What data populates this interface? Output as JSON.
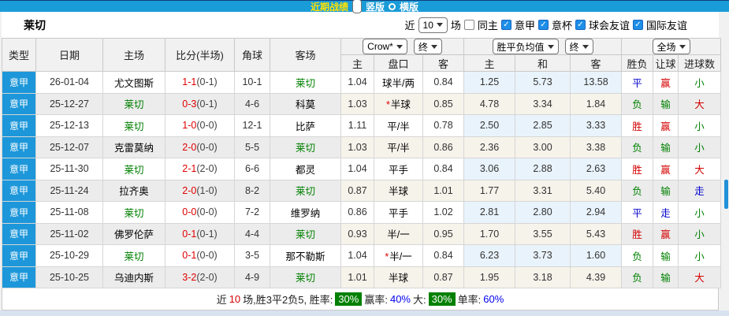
{
  "topbar": {
    "title": "近期战绩",
    "options": [
      {
        "label": "竖版",
        "selected": true
      },
      {
        "label": "横版",
        "selected": false
      }
    ]
  },
  "filter": {
    "team": "莱切",
    "near_label": "近",
    "count_value": "10",
    "suffix_label": "场",
    "same_home_label": "同主",
    "leagues": [
      {
        "label": "意甲",
        "checked": true
      },
      {
        "label": "意杯",
        "checked": true
      },
      {
        "label": "球会友谊",
        "checked": true
      },
      {
        "label": "国际友谊",
        "checked": true
      }
    ]
  },
  "controls": {
    "bookmaker_select": "Crow*",
    "bookmaker_final_select": "终",
    "avg_select": "胜平负均值",
    "avg_final_select": "终",
    "scope_select": "全场"
  },
  "header": {
    "left": [
      "类型",
      "日期",
      "主场",
      "比分(半场)",
      "角球",
      "客场"
    ],
    "sub": [
      "主",
      "盘口",
      "客",
      "主",
      "和",
      "客",
      "胜负",
      "让球",
      "进球数"
    ]
  },
  "rows": [
    {
      "league": "意甲",
      "date": "26-01-04",
      "home": "尤文图斯",
      "home_team": false,
      "score": "1-1",
      "half": "(0-1)",
      "corners": "10-1",
      "away": "莱切",
      "away_team": true,
      "crow_home": "1.04",
      "star": false,
      "handicap": "球半/两",
      "crow_away": "0.84",
      "avg_home": "1.25",
      "avg_draw": "5.73",
      "avg_away": "13.58",
      "result": "平",
      "result_color": "blue",
      "spread": "赢",
      "spread_color": "red",
      "goals": "小",
      "goals_color": "green"
    },
    {
      "league": "意甲",
      "date": "25-12-27",
      "home": "莱切",
      "home_team": true,
      "score": "0-3",
      "half": "(0-1)",
      "corners": "4-6",
      "away": "科莫",
      "away_team": false,
      "crow_home": "1.03",
      "star": true,
      "handicap": "半球",
      "crow_away": "0.85",
      "avg_home": "4.78",
      "avg_draw": "3.34",
      "avg_away": "1.84",
      "result": "负",
      "result_color": "green",
      "spread": "输",
      "spread_color": "green",
      "goals": "大",
      "goals_color": "red"
    },
    {
      "league": "意甲",
      "date": "25-12-13",
      "home": "莱切",
      "home_team": true,
      "score": "1-0",
      "half": "(0-0)",
      "corners": "12-1",
      "away": "比萨",
      "away_team": false,
      "crow_home": "1.11",
      "star": false,
      "handicap": "平/半",
      "crow_away": "0.78",
      "avg_home": "2.50",
      "avg_draw": "2.85",
      "avg_away": "3.33",
      "result": "胜",
      "result_color": "red",
      "spread": "赢",
      "spread_color": "red",
      "goals": "小",
      "goals_color": "green"
    },
    {
      "league": "意甲",
      "date": "25-12-07",
      "home": "克雷莫纳",
      "home_team": false,
      "score": "2-0",
      "half": "(0-0)",
      "corners": "5-5",
      "away": "莱切",
      "away_team": true,
      "crow_home": "1.03",
      "star": false,
      "handicap": "平/半",
      "crow_away": "0.86",
      "avg_home": "2.36",
      "avg_draw": "3.00",
      "avg_away": "3.38",
      "result": "负",
      "result_color": "green",
      "spread": "输",
      "spread_color": "green",
      "goals": "小",
      "goals_color": "green"
    },
    {
      "league": "意甲",
      "date": "25-11-30",
      "home": "莱切",
      "home_team": true,
      "score": "2-1",
      "half": "(2-0)",
      "corners": "6-6",
      "away": "都灵",
      "away_team": false,
      "crow_home": "1.04",
      "star": false,
      "handicap": "平手",
      "crow_away": "0.84",
      "avg_home": "3.06",
      "avg_draw": "2.88",
      "avg_away": "2.63",
      "result": "胜",
      "result_color": "red",
      "spread": "赢",
      "spread_color": "red",
      "goals": "大",
      "goals_color": "red"
    },
    {
      "league": "意甲",
      "date": "25-11-24",
      "home": "拉齐奥",
      "home_team": false,
      "score": "2-0",
      "half": "(1-0)",
      "corners": "8-2",
      "away": "莱切",
      "away_team": true,
      "crow_home": "0.87",
      "star": false,
      "handicap": "半球",
      "crow_away": "1.01",
      "avg_home": "1.77",
      "avg_draw": "3.31",
      "avg_away": "5.40",
      "result": "负",
      "result_color": "green",
      "spread": "输",
      "spread_color": "green",
      "goals": "走",
      "goals_color": "blue"
    },
    {
      "league": "意甲",
      "date": "25-11-08",
      "home": "莱切",
      "home_team": true,
      "score": "0-0",
      "half": "(0-0)",
      "corners": "7-2",
      "away": "维罗纳",
      "away_team": false,
      "crow_home": "0.86",
      "star": false,
      "handicap": "平手",
      "crow_away": "1.02",
      "avg_home": "2.81",
      "avg_draw": "2.80",
      "avg_away": "2.94",
      "result": "平",
      "result_color": "blue",
      "spread": "走",
      "spread_color": "blue",
      "goals": "小",
      "goals_color": "green"
    },
    {
      "league": "意甲",
      "date": "25-11-02",
      "home": "佛罗伦萨",
      "home_team": false,
      "score": "0-1",
      "half": "(0-1)",
      "corners": "4-4",
      "away": "莱切",
      "away_team": true,
      "crow_home": "0.93",
      "star": false,
      "handicap": "半/一",
      "crow_away": "0.95",
      "avg_home": "1.70",
      "avg_draw": "3.55",
      "avg_away": "5.43",
      "result": "胜",
      "result_color": "red",
      "spread": "赢",
      "spread_color": "red",
      "goals": "小",
      "goals_color": "green"
    },
    {
      "league": "意甲",
      "date": "25-10-29",
      "home": "莱切",
      "home_team": true,
      "score": "0-1",
      "half": "(0-0)",
      "corners": "3-5",
      "away": "那不勒斯",
      "away_team": false,
      "crow_home": "1.04",
      "star": true,
      "handicap": "半/一",
      "crow_away": "0.84",
      "avg_home": "6.23",
      "avg_draw": "3.73",
      "avg_away": "1.60",
      "result": "负",
      "result_color": "green",
      "spread": "输",
      "spread_color": "green",
      "goals": "小",
      "goals_color": "green"
    },
    {
      "league": "意甲",
      "date": "25-10-25",
      "home": "乌迪内斯",
      "home_team": false,
      "score": "3-2",
      "half": "(2-0)",
      "corners": "4-9",
      "away": "莱切",
      "away_team": true,
      "crow_home": "1.01",
      "star": false,
      "handicap": "半球",
      "crow_away": "0.87",
      "avg_home": "1.95",
      "avg_draw": "3.18",
      "avg_away": "4.39",
      "result": "负",
      "result_color": "green",
      "spread": "输",
      "spread_color": "green",
      "goals": "大",
      "goals_color": "red"
    }
  ],
  "footer": {
    "seg_near": "近",
    "seg_count": "10",
    "seg_record": "场,胜3平2负5, 胜率:",
    "badge_win": "30%",
    "seg_spread": "赢率:",
    "val_spread": "40%",
    "seg_big": "大:",
    "badge_big": "30%",
    "seg_single": "单率:",
    "val_single": "60%"
  },
  "colors": {
    "topbar_blue": "#1a9cd8",
    "league_badge_blue": "#1d97da",
    "team_green": "#008000",
    "score_red": "#e10000",
    "result_red": "#d40000",
    "result_green": "#008000",
    "result_blue": "#0000cc",
    "badge_green_bg": "#008000",
    "value_blue": "#0000ee",
    "avg_col_bg": "#e9f3fb"
  }
}
